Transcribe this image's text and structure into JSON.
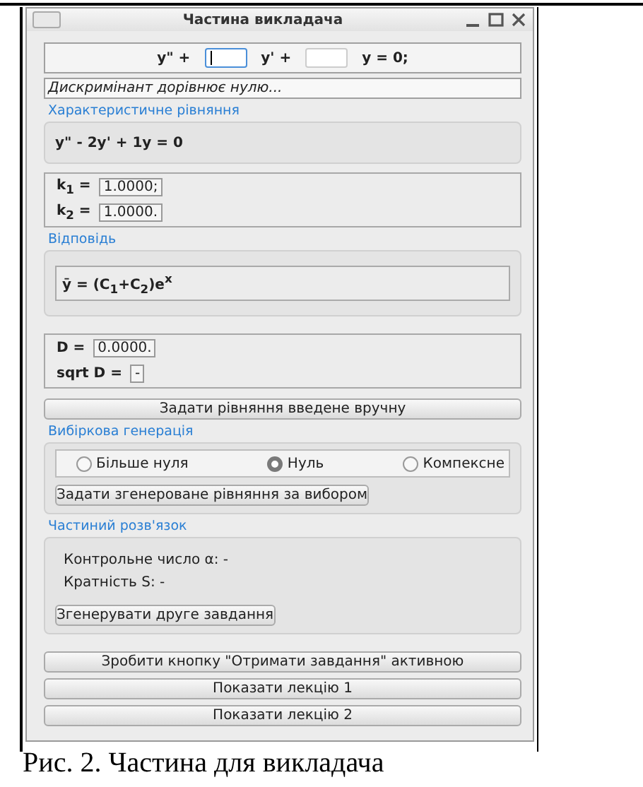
{
  "window": {
    "title": "Частина викладача"
  },
  "equation": [
    {
      "kind": "text",
      "text": "y\" +"
    },
    {
      "kind": "input",
      "focused": true
    },
    {
      "kind": "text",
      "text": "y' +"
    },
    {
      "kind": "input",
      "focused": false
    },
    {
      "kind": "text",
      "text": "y = 0;"
    }
  ],
  "message": "Дискримінант дорівнює нулю...",
  "characteristic": {
    "title": "Характеристичне рівняння",
    "equation": "y\" - 2y' + 1y = 0"
  },
  "roots": [
    {
      "label": "k$_{1}$ =",
      "value": "1.0000;"
    },
    {
      "label": "k$_{2}$ =",
      "value": "1.0000."
    }
  ],
  "answer": {
    "title": "Відповідь",
    "formula": "ȳ = (C$_{1}$+C$_{2}$)e$^{x}$"
  },
  "discriminant": [
    {
      "label": "D =",
      "value": "0.0000."
    },
    {
      "label": "sqrt D =",
      "value": "-"
    }
  ],
  "manual_button": "Задати рівняння введене вручну",
  "generation": {
    "title": "Вибіркова генерація",
    "options": [
      {
        "label": "Більше нуля",
        "selected": false
      },
      {
        "label": "Нуль",
        "selected": true
      },
      {
        "label": "Компексне",
        "selected": false
      }
    ],
    "button": "Задати згенероване рівняння за вибором"
  },
  "particular": {
    "title": "Частиний розв'язок",
    "lines": [
      "Контрольне число α: -",
      "Кратність S: -"
    ],
    "button": "Згенерувати друге завдання"
  },
  "bottom_buttons": [
    "Зробити кнопку \"Отримати завдання\" активною",
    "Показати лекцію 1",
    "Показати лекцію 2"
  ],
  "caption": "Рис. 2. Частина для викладача"
}
